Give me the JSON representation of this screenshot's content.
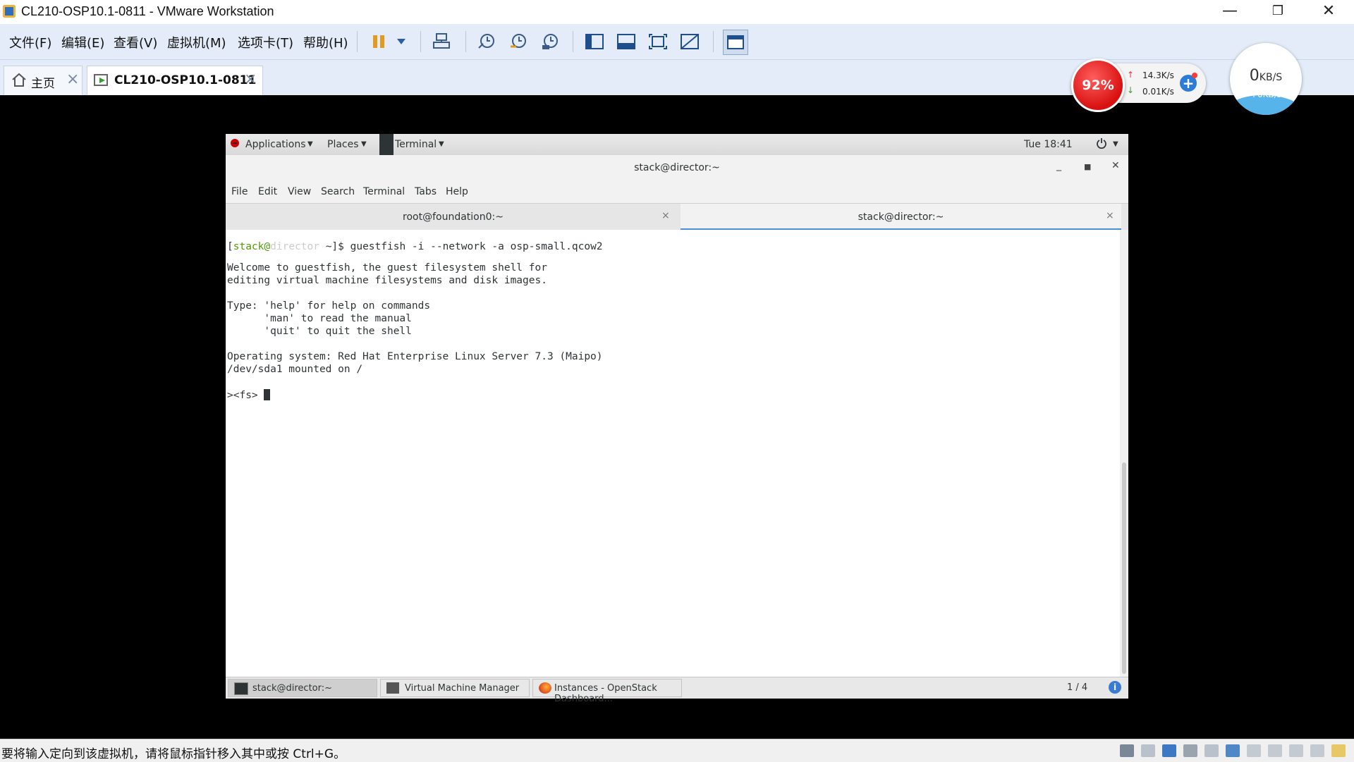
{
  "window": {
    "title": "CL210-OSP10.1-0811 - VMware Workstation",
    "controls": {
      "minimize": "—",
      "restore": "❐",
      "close": "✕"
    }
  },
  "menubar": {
    "items": [
      "文件(F)",
      "编辑(E)",
      "查看(V)",
      "虚拟机(M)",
      "选项卡(T)",
      "帮助(H)"
    ]
  },
  "toolbar": {
    "icons": [
      "pause-icon",
      "dropdown-icon",
      "send-ctrl-alt-del-icon",
      "snapshot-icon",
      "revert-snapshot-icon",
      "snapshot-manager-icon",
      "console-view-icon",
      "thumbnail-bar-icon",
      "fullscreen-icon",
      "unity-icon",
      "library-icon"
    ]
  },
  "vm_tabs": [
    {
      "label": "主页",
      "active": false
    },
    {
      "label": "CL210-OSP10.1-0811",
      "active": true
    }
  ],
  "network_widget": {
    "percent": "92%",
    "upload": "14.3K/s",
    "download": "0.01K/s",
    "plus": "+",
    "speed_main": "0",
    "speed_unit": "KB/S",
    "speed_sub": "+0KB/s"
  },
  "gnome": {
    "topbar": {
      "applications": "Applications",
      "places": "Places",
      "terminal": "Terminal",
      "clock": "Tue 18:41"
    },
    "terminal": {
      "title": "stack@director:~",
      "menu": [
        "File",
        "Edit",
        "View",
        "Search",
        "Terminal",
        "Tabs",
        "Help"
      ],
      "tabs": [
        {
          "label": "root@foundation0:~",
          "active": false
        },
        {
          "label": "stack@director:~",
          "active": true
        }
      ],
      "prompt": {
        "open": "[",
        "user": "stack@",
        "host": "director",
        "rest": " ~]$ guestfish -i --network -a osp-small.qcow2"
      },
      "lines": [
        "Welcome to guestfish, the guest filesystem shell for",
        "editing virtual machine filesystems and disk images.",
        "",
        "Type: 'help' for help on commands",
        "      'man' to read the manual",
        "      'quit' to quit the shell",
        "",
        "Operating system: Red Hat Enterprise Linux Server 7.3 (Maipo)",
        "/dev/sda1 mounted on /",
        ""
      ],
      "fs_prompt": "><fs> "
    },
    "taskbar": {
      "items": [
        "stack@director:~",
        "Virtual Machine Manager",
        "Instances - OpenStack Dashboard..."
      ],
      "workspace": "1 / 4",
      "info": "i"
    }
  },
  "statusbar": {
    "text": "要将输入定向到该虚拟机，请将鼠标指针移入其中或按 Ctrl+G。"
  },
  "colors": {
    "accent": "#4a90d9",
    "prompt_user": "#4e9a06",
    "percent_badge": "#d81010",
    "vmware_chrome": "#e3ecf8"
  }
}
